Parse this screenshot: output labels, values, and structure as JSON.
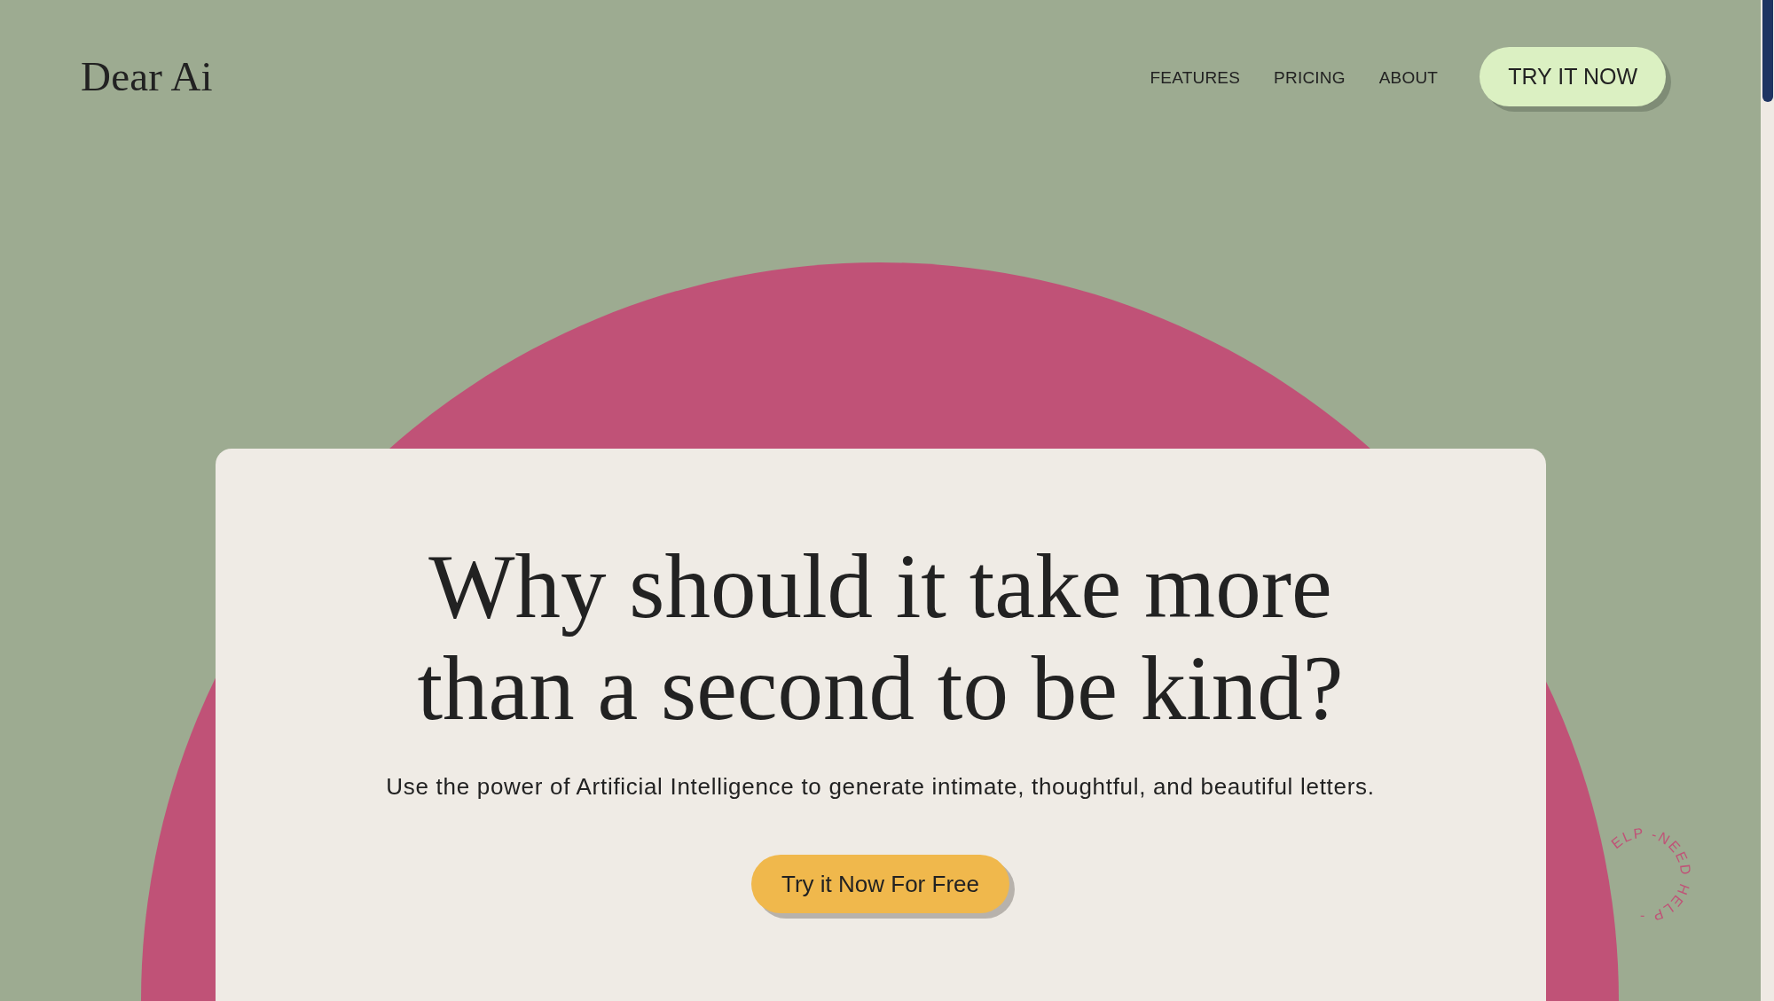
{
  "logo": {
    "text": "Dear Ai"
  },
  "nav": {
    "links": [
      {
        "label": "FEATURES"
      },
      {
        "label": "PRICING"
      },
      {
        "label": "ABOUT"
      }
    ],
    "cta": "TRY IT NOW"
  },
  "hero": {
    "heading": "Why should it take more than a second to be kind?",
    "subtitle": "Use the power of Artificial Intelligence to generate intimate, thoughtful, and beautiful letters.",
    "cta": "Try it Now For Free"
  },
  "help_badge": {
    "text": "ELP -NEED HELP -"
  }
}
